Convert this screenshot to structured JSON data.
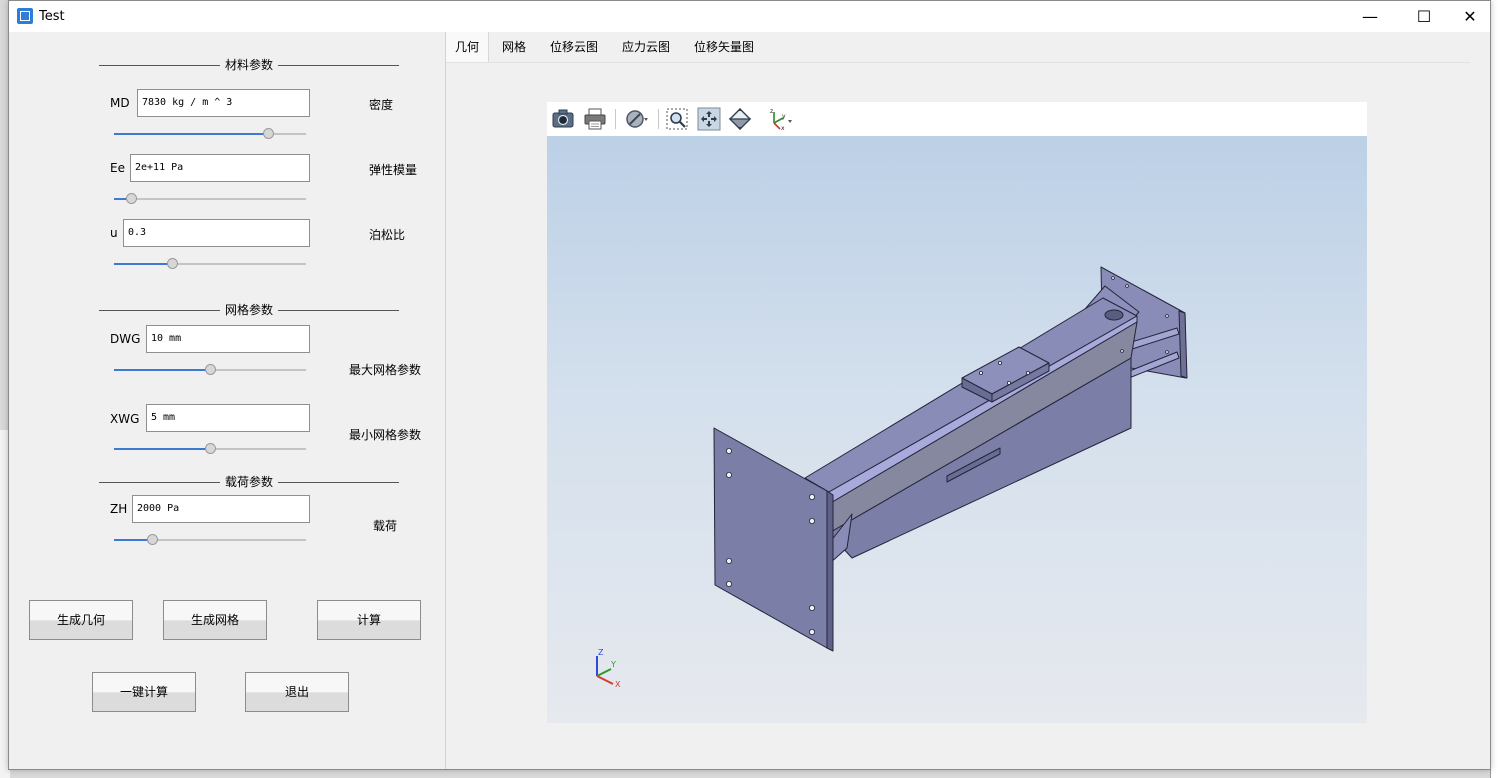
{
  "window": {
    "title": "Test",
    "controls": {
      "minimize": "—",
      "maximize": "☐",
      "close": "✕"
    }
  },
  "material": {
    "title": "材料参数",
    "params": [
      {
        "label": "MD",
        "value": "7830 kg / m ^ 3",
        "desc": "密度",
        "slider": 0.8
      },
      {
        "label": "Ee",
        "value": "2e+11 Pa",
        "desc": "弹性模量",
        "slider": 0.09
      },
      {
        "label": "u",
        "value": "0.3",
        "desc": "泊松比",
        "slider": 0.3
      }
    ]
  },
  "mesh": {
    "title": "网格参数",
    "params": [
      {
        "label": "DWG",
        "value": "10 mm",
        "desc": "最大网格参数",
        "slider": 0.5
      },
      {
        "label": "XWG",
        "value": "5 mm",
        "desc": "最小网格参数",
        "slider": 0.5
      }
    ]
  },
  "load": {
    "title": "载荷参数",
    "params": [
      {
        "label": "ZH",
        "value": "2000 Pa",
        "desc": "载荷",
        "slider": 0.2
      }
    ]
  },
  "buttons": {
    "gen_geometry": "生成几何",
    "gen_mesh": "生成网格",
    "compute": "计算",
    "one_click": "一键计算",
    "exit": "退出"
  },
  "tabs": [
    "几何",
    "网格",
    "位移云图",
    "应力云图",
    "位移矢量图"
  ],
  "active_tab": 0,
  "viewer": {
    "toolbar_icons": [
      "camera-icon",
      "print-icon",
      "hide-shape-icon",
      "zoom-region-icon",
      "zoom-fit-icon",
      "view-reset-icon",
      "axes-orientation-icon"
    ],
    "triad": {
      "z": "Z",
      "y": "Y",
      "x": "X"
    }
  },
  "colors": {
    "slider_fill": "#3e7bd0",
    "model_face_top": "#8a8cb8",
    "model_face_side": "#7b7ea6",
    "model_edge": "#24243a",
    "model_highlight": "#a8aadc"
  }
}
